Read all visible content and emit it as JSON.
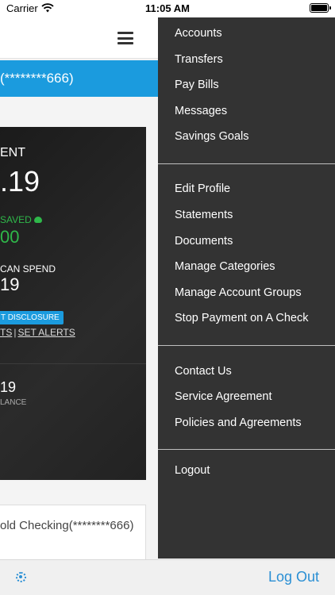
{
  "status_bar": {
    "carrier": "Carrier",
    "time": "11:05 AM"
  },
  "background": {
    "account_banner": "(********666)",
    "card": {
      "current_label": "ENT",
      "current_balance": ".19",
      "saved_label": "SAVED",
      "saved_amount": "00",
      "spend_label": "CAN SPEND",
      "spend_amount": "19",
      "disclosure_button": "T DISCLOSURE",
      "link_left": "TS",
      "link_separator": "|",
      "link_set_alerts": "SET ALERTS",
      "available_amount": "19",
      "available_label": "LANCE"
    },
    "second_account": "old Checking(********666)",
    "bottom_bar": {
      "logout": "Log Out"
    }
  },
  "menu": {
    "group1": [
      "Accounts",
      "Transfers",
      "Pay Bills",
      "Messages",
      "Savings Goals"
    ],
    "group2": [
      "Edit Profile",
      "Statements",
      "Documents",
      "Manage Categories",
      "Manage Account Groups",
      "Stop Payment on A Check"
    ],
    "group3": [
      "Contact Us",
      "Service Agreement",
      "Policies and Agreements"
    ],
    "group4": [
      "Logout"
    ]
  },
  "colors": {
    "accent_blue": "#1b9bde",
    "saved_green": "#2fb84a",
    "drawer_bg": "#333333"
  }
}
